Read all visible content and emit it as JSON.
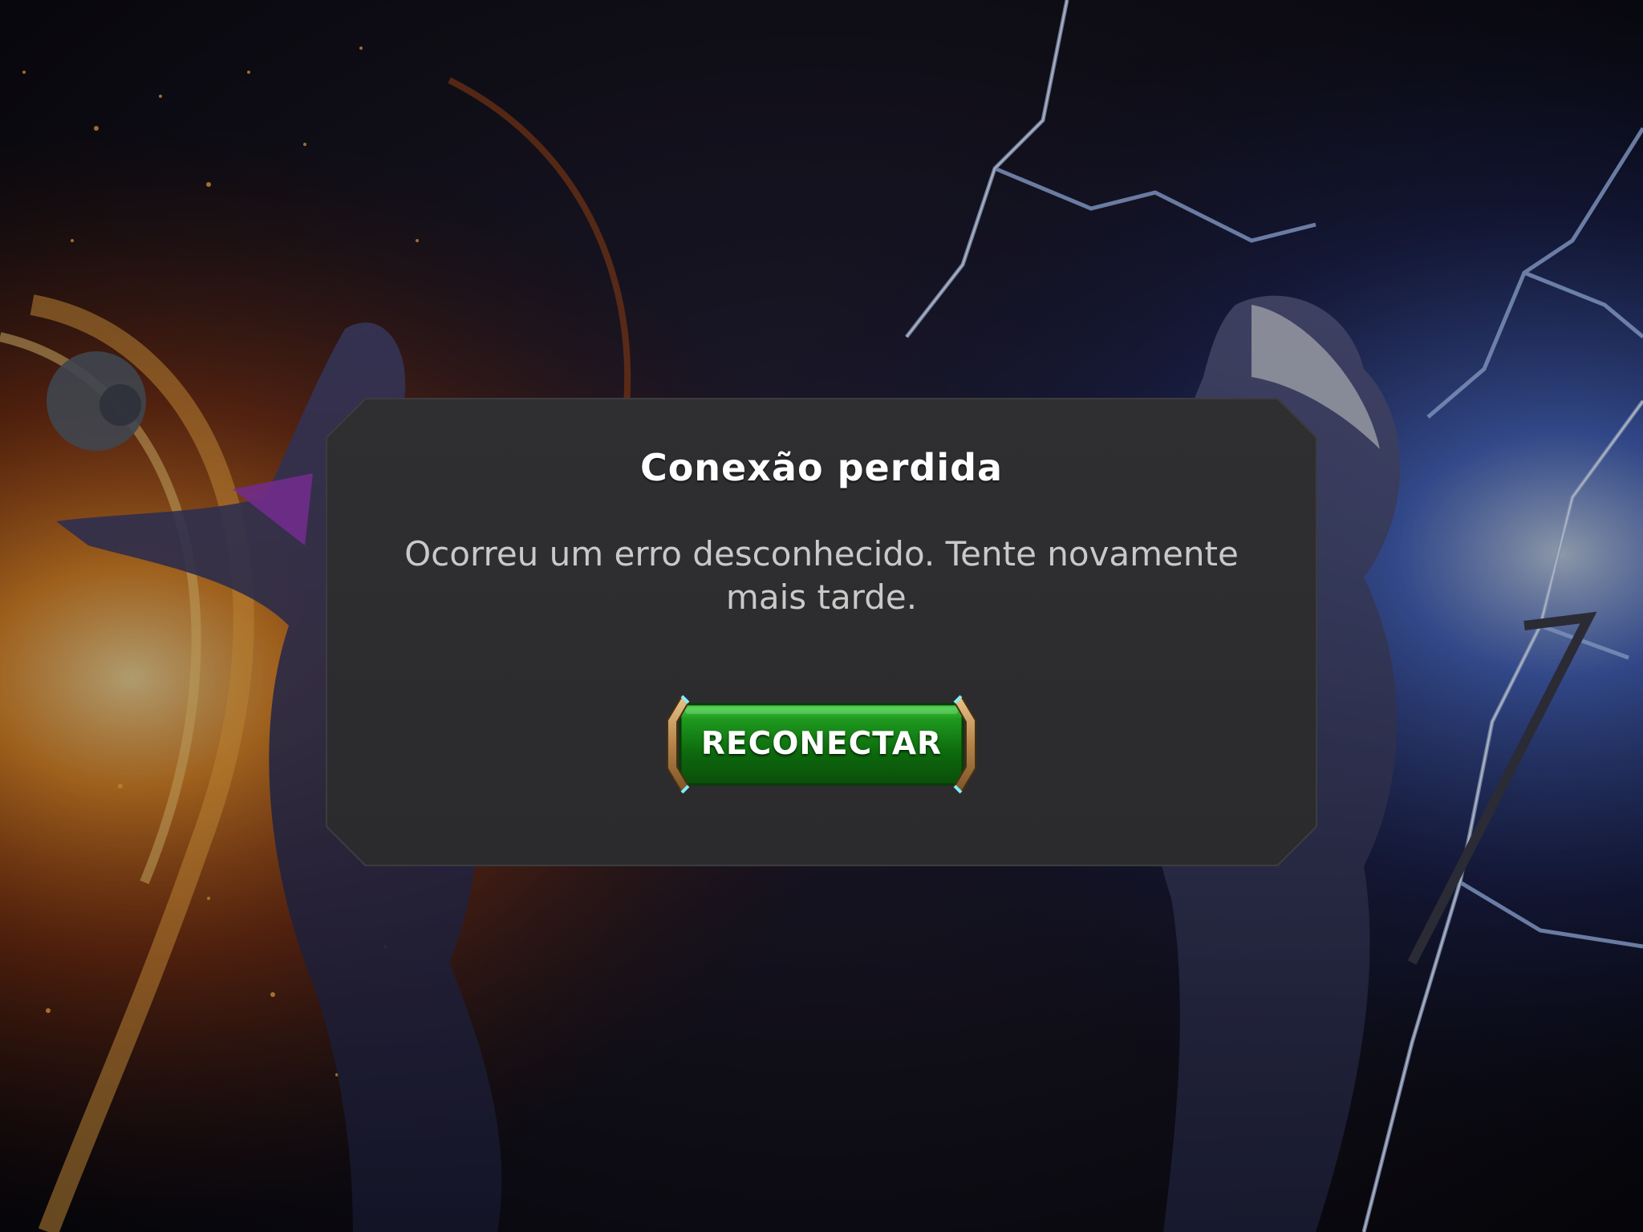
{
  "dialog": {
    "title": "Conexão perdida",
    "message": "Ocorreu um erro desconhecido. Tente novamente mais tarde.",
    "button_label": "RECONECTAR"
  },
  "colors": {
    "button_green": "#1e8a1e",
    "dialog_bg": "#2e2e30",
    "title": "#ffffff",
    "message": "#c9c9c9"
  }
}
